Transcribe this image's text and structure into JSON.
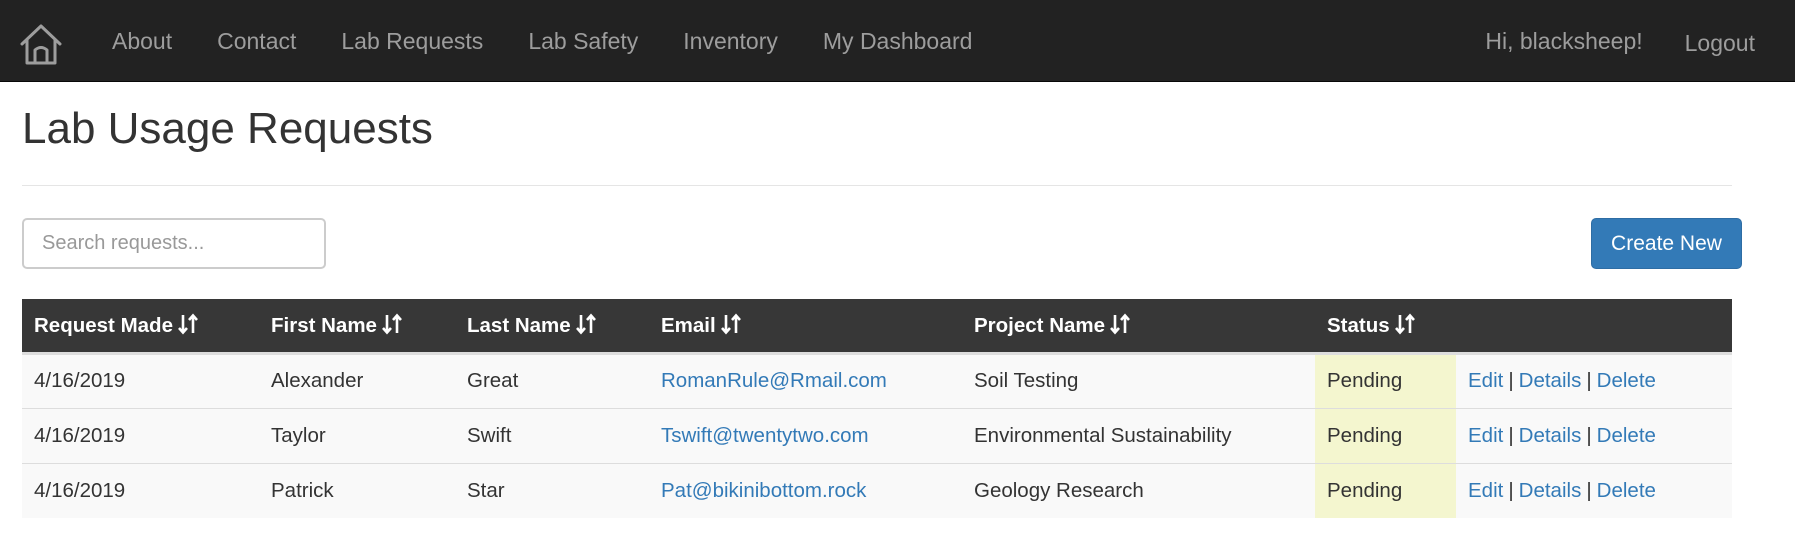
{
  "nav": {
    "items": [
      {
        "label": "About",
        "name": "nav-about"
      },
      {
        "label": "Contact",
        "name": "nav-contact"
      },
      {
        "label": "Lab Requests",
        "name": "nav-lab-requests"
      },
      {
        "label": "Lab Safety",
        "name": "nav-lab-safety"
      },
      {
        "label": "Inventory",
        "name": "nav-inventory"
      },
      {
        "label": "My Dashboard",
        "name": "nav-my-dashboard"
      }
    ],
    "greeting": "Hi, blacksheep!",
    "logout": "Logout",
    "home_icon": "home-icon"
  },
  "page": {
    "title": "Lab Usage Requests"
  },
  "search": {
    "placeholder": "Search requests...",
    "value": ""
  },
  "create_button": "Create New",
  "table": {
    "sort_icon": "sort-icon",
    "columns": [
      "Request Made",
      "First Name",
      "Last Name",
      "Email",
      "Project Name",
      "Status",
      ""
    ],
    "rows": [
      {
        "request_made": "4/16/2019",
        "first_name": "Alexander",
        "last_name": "Great",
        "email": "RomanRule@Rmail.com",
        "project": "Soil Testing",
        "status": "Pending"
      },
      {
        "request_made": "4/16/2019",
        "first_name": "Taylor",
        "last_name": "Swift",
        "email": "Tswift@twentytwo.com",
        "project": "Environmental Sustainability",
        "status": "Pending"
      },
      {
        "request_made": "4/16/2019",
        "first_name": "Patrick",
        "last_name": "Star",
        "email": "Pat@bikinibottom.rock",
        "project": "Geology Research",
        "status": "Pending"
      }
    ],
    "actions": {
      "edit": "Edit",
      "details": "Details",
      "delete": "Delete",
      "separator": "|"
    }
  },
  "colors": {
    "navbar": "#222222",
    "nav_text": "#9d9d9d",
    "table_header": "#373737",
    "link": "#337ab7",
    "primary_button": "#337ab7",
    "status_highlight": "#f4f6cf"
  }
}
